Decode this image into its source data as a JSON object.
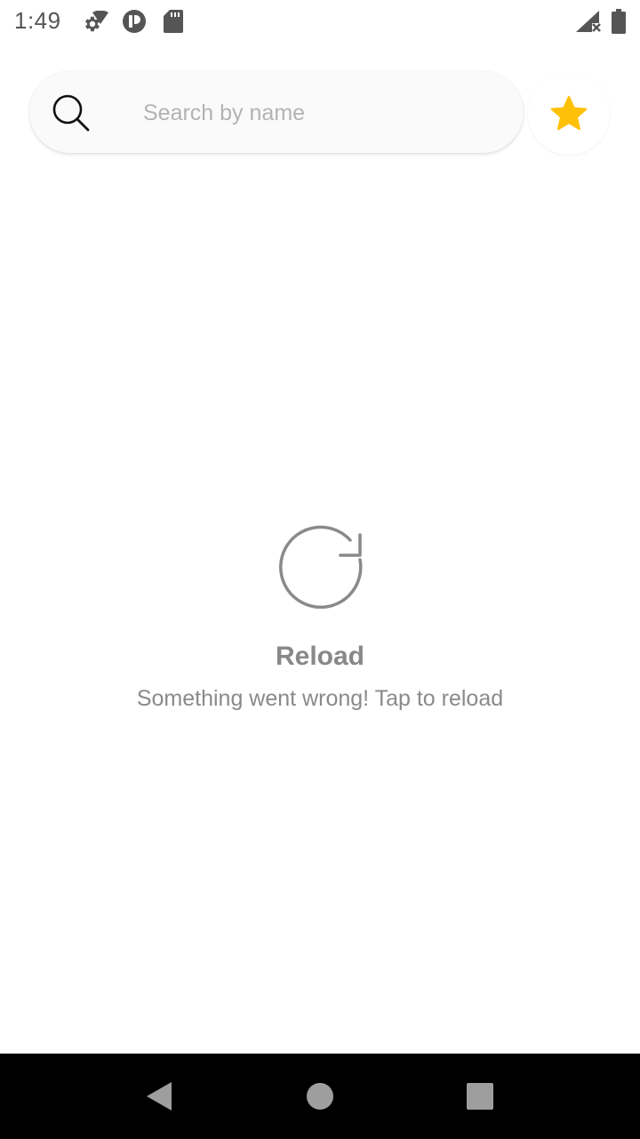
{
  "status_bar": {
    "time": "1:49",
    "icons": [
      "settings-icon",
      "wifi-icon",
      "app-notification-icon",
      "sd-card-icon",
      "signal-no-data-icon",
      "battery-icon"
    ]
  },
  "search": {
    "placeholder": "Search by name",
    "value": ""
  },
  "favorites": {
    "icon": "star-icon",
    "color": "#FFC107"
  },
  "reload": {
    "icon": "reload-icon",
    "title": "Reload",
    "message": "Something went wrong! Tap to reload"
  },
  "nav_bar": {
    "buttons": [
      "back-icon",
      "home-icon",
      "recents-icon"
    ]
  }
}
